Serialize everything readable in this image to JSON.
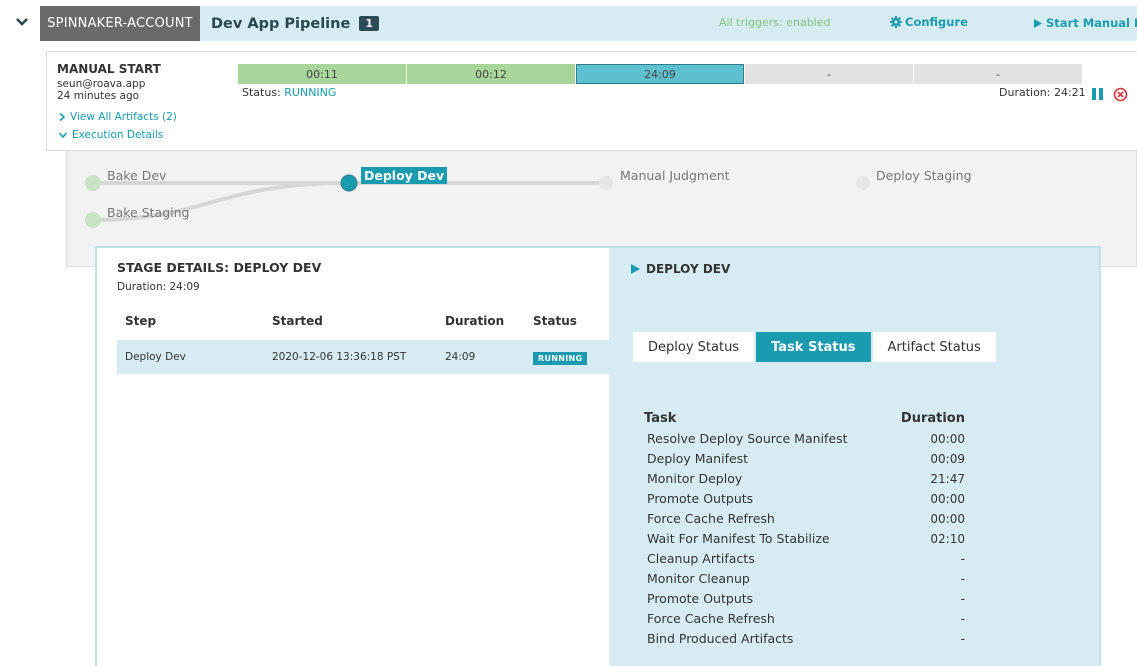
{
  "header": {
    "account": "SPINNAKER-ACCOUNT",
    "pipeline_title": "Dev App Pipeline",
    "pipeline_count": "1",
    "triggers": "All triggers: enabled",
    "configure": "Configure",
    "start_manual": "Start Manual Exec"
  },
  "execution": {
    "trigger": "MANUAL START",
    "user": "seun@roava.app",
    "time_ago": "24 minutes ago",
    "view_artifacts": "View All Artifacts (2)",
    "execution_details": "Execution Details",
    "status_label": "Status:",
    "status_value": "RUNNING",
    "duration": "Duration: 24:21",
    "bars": [
      {
        "label": "00:11",
        "state": "succeeded"
      },
      {
        "label": "00:12",
        "state": "succeeded"
      },
      {
        "label": "24:09",
        "state": "running"
      },
      {
        "label": "-",
        "state": "not_started"
      },
      {
        "label": "-",
        "state": "not_started"
      }
    ]
  },
  "graph": {
    "nodes": {
      "bake_dev": "Bake Dev",
      "bake_staging": "Bake Staging",
      "deploy_dev": "Deploy Dev",
      "manual_judgment": "Manual Judgment",
      "deploy_staging": "Deploy Staging"
    }
  },
  "stage_details": {
    "title": "STAGE DETAILS: DEPLOY DEV",
    "duration": "Duration: 24:09",
    "columns": {
      "step": "Step",
      "started": "Started",
      "duration": "Duration",
      "status": "Status"
    },
    "row": {
      "step": "Deploy Dev",
      "started": "2020-12-06 13:36:18 PST",
      "duration": "24:09",
      "status": "RUNNING"
    }
  },
  "task_panel": {
    "title": "DEPLOY DEV",
    "tabs": [
      "Deploy Status",
      "Task Status",
      "Artifact Status"
    ],
    "active_tab": "Task Status",
    "col_task": "Task",
    "col_duration": "Duration",
    "tasks": [
      {
        "name": "Resolve Deploy Source Manifest",
        "duration": "00:00"
      },
      {
        "name": "Deploy Manifest",
        "duration": "00:09"
      },
      {
        "name": "Monitor Deploy",
        "duration": "21:47"
      },
      {
        "name": "Promote Outputs",
        "duration": "00:00"
      },
      {
        "name": "Force Cache Refresh",
        "duration": "00:00"
      },
      {
        "name": "Wait For Manifest To Stabilize",
        "duration": "02:10"
      },
      {
        "name": "Cleanup Artifacts",
        "duration": "-"
      },
      {
        "name": "Monitor Cleanup",
        "duration": "-"
      },
      {
        "name": "Promote Outputs",
        "duration": "-"
      },
      {
        "name": "Force Cache Refresh",
        "duration": "-"
      },
      {
        "name": "Bind Produced Artifacts",
        "duration": "-"
      }
    ]
  },
  "colors": {
    "accent": "#1a9bb0",
    "succeeded": "#a8d59a",
    "running": "#5ec0ce",
    "header_bg": "#d7ecf2"
  }
}
